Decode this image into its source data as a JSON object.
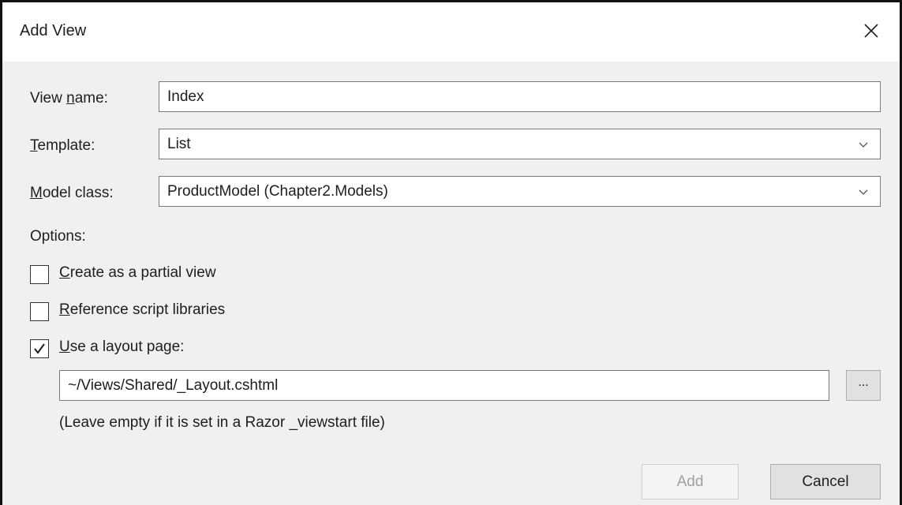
{
  "dialog": {
    "title": "Add View",
    "close_icon": "close-icon"
  },
  "form": {
    "view_name": {
      "label_pre": "View ",
      "label_access": "n",
      "label_post": "ame:",
      "value": "Index"
    },
    "template": {
      "label_access": "T",
      "label_post": "emplate:",
      "value": "List"
    },
    "model_class": {
      "label_access": "M",
      "label_post": "odel class:",
      "value": "ProductModel (Chapter2.Models)"
    },
    "options_label": "Options:",
    "partial_view": {
      "checked": false,
      "label_access": "C",
      "label_post": "reate as a partial view"
    },
    "script_libraries": {
      "checked": false,
      "label_access": "R",
      "label_post": "eference script libraries"
    },
    "layout_page": {
      "checked": true,
      "label_access": "U",
      "label_post": "se a layout page:"
    },
    "layout_path": "~/Views/Shared/_Layout.cshtml",
    "browse_label": "...",
    "hint": "(Leave empty if it is set in a Razor _viewstart file)"
  },
  "buttons": {
    "add_label": "Add",
    "add_enabled": false,
    "cancel_label": "Cancel"
  }
}
